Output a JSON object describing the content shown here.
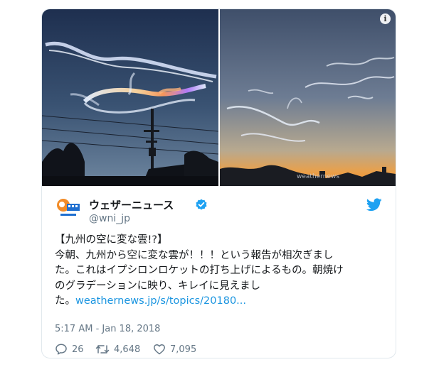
{
  "tweet": {
    "display_name": "ウェザーニュース",
    "handle": "@wni_jp",
    "text_lines": [
      "【九州の空に変な雲!?】",
      "今朝、九州から空に変な雲が！！！という報告が相次ぎまし",
      "た。これはイプシロンロケットの打ち上げによるもの。朝焼け",
      "のグラデーションに映り、キレイに見えまし"
    ],
    "text_tail_prefix": "た。",
    "link_text": "weathernews.jp/s/topics/20180...",
    "timestamp": "5:17 AM - Jan 18, 2018",
    "info_glyph": "i"
  },
  "stats": {
    "replies": "26",
    "retweets": "4,648",
    "likes": "7,095"
  },
  "icons": {
    "info": "info-icon",
    "verified": "verified-badge-icon",
    "twitter": "twitter-bird-icon",
    "reply": "reply-icon",
    "retweet": "retweet-icon",
    "like": "heart-icon"
  },
  "photo_watermark": "weathernews",
  "colors": {
    "link": "#1b95e0",
    "verified": "#1da1f2",
    "twitter_blue": "#1da1f2",
    "muted": "#657786",
    "text": "#14171a"
  }
}
